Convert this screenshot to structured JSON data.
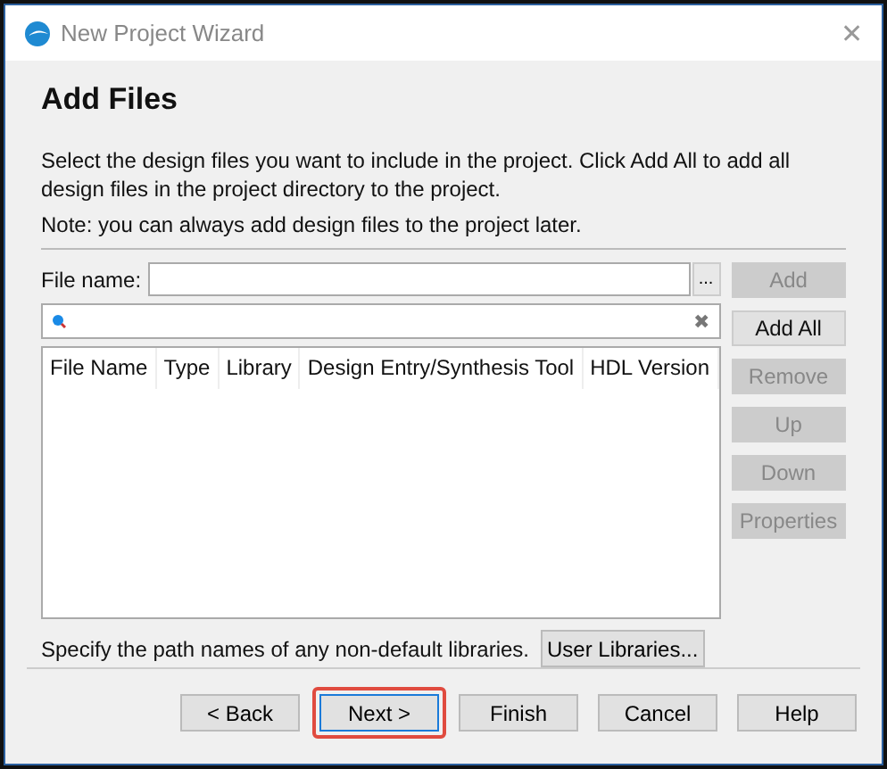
{
  "window": {
    "title": "New Project Wizard",
    "close": "✕"
  },
  "heading": "Add Files",
  "description": "Select the design files you want to include in the project. Click Add All to add all design files in the project directory to the project.",
  "note": "Note: you can always add design files to the project later.",
  "file_name": {
    "label": "File name:",
    "browse": "..."
  },
  "filter": {
    "clear": "✖"
  },
  "table": {
    "columns": [
      "File Name",
      "Type",
      "Library",
      "Design Entry/Synthesis Tool",
      "HDL Version"
    ]
  },
  "side_buttons": [
    {
      "label": "Add",
      "disabled": true
    },
    {
      "label": "Add All",
      "disabled": false
    },
    {
      "label": "Remove",
      "disabled": true
    },
    {
      "label": "Up",
      "disabled": true
    },
    {
      "label": "Down",
      "disabled": true
    },
    {
      "label": "Properties",
      "disabled": true
    }
  ],
  "libraries": {
    "text": "Specify the path names of any non-default libraries.",
    "button": "User Libraries..."
  },
  "nav_buttons": [
    {
      "label": "< Back",
      "focused": false,
      "highlighted": false
    },
    {
      "label": "Next >",
      "focused": true,
      "highlighted": true
    },
    {
      "label": "Finish",
      "focused": false,
      "highlighted": false
    },
    {
      "label": "Cancel",
      "focused": false,
      "highlighted": false
    },
    {
      "label": "Help",
      "focused": false,
      "highlighted": false
    }
  ]
}
